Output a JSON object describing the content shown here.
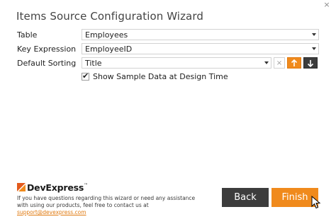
{
  "window": {
    "title": "Items Source Configuration Wizard",
    "close_glyph": "×"
  },
  "form": {
    "table": {
      "label": "Table",
      "value": "Employees"
    },
    "key_expression": {
      "label": "Key Expression",
      "value": "EmployeeID"
    },
    "default_sorting": {
      "label": "Default Sorting",
      "value": "Title",
      "clear_glyph": "×",
      "ascending_icon": "arrow-up-icon",
      "descending_icon": "arrow-down-icon"
    },
    "show_sample_data": {
      "label": "Show Sample Data at Design Time",
      "checked": true,
      "tick": "✔"
    }
  },
  "footer": {
    "logo_text": "DevExpress",
    "logo_trademark": "™",
    "help_text_line1": "If you have questions regarding this wizard or need any assistance",
    "help_text_line2": "with using our products, feel free to contact us at ",
    "support_email": "support@devexpress.com"
  },
  "buttons": {
    "back": "Back",
    "finish": "Finish"
  },
  "colors": {
    "accent": "#f08a1c",
    "dark": "#3c3c3c"
  }
}
